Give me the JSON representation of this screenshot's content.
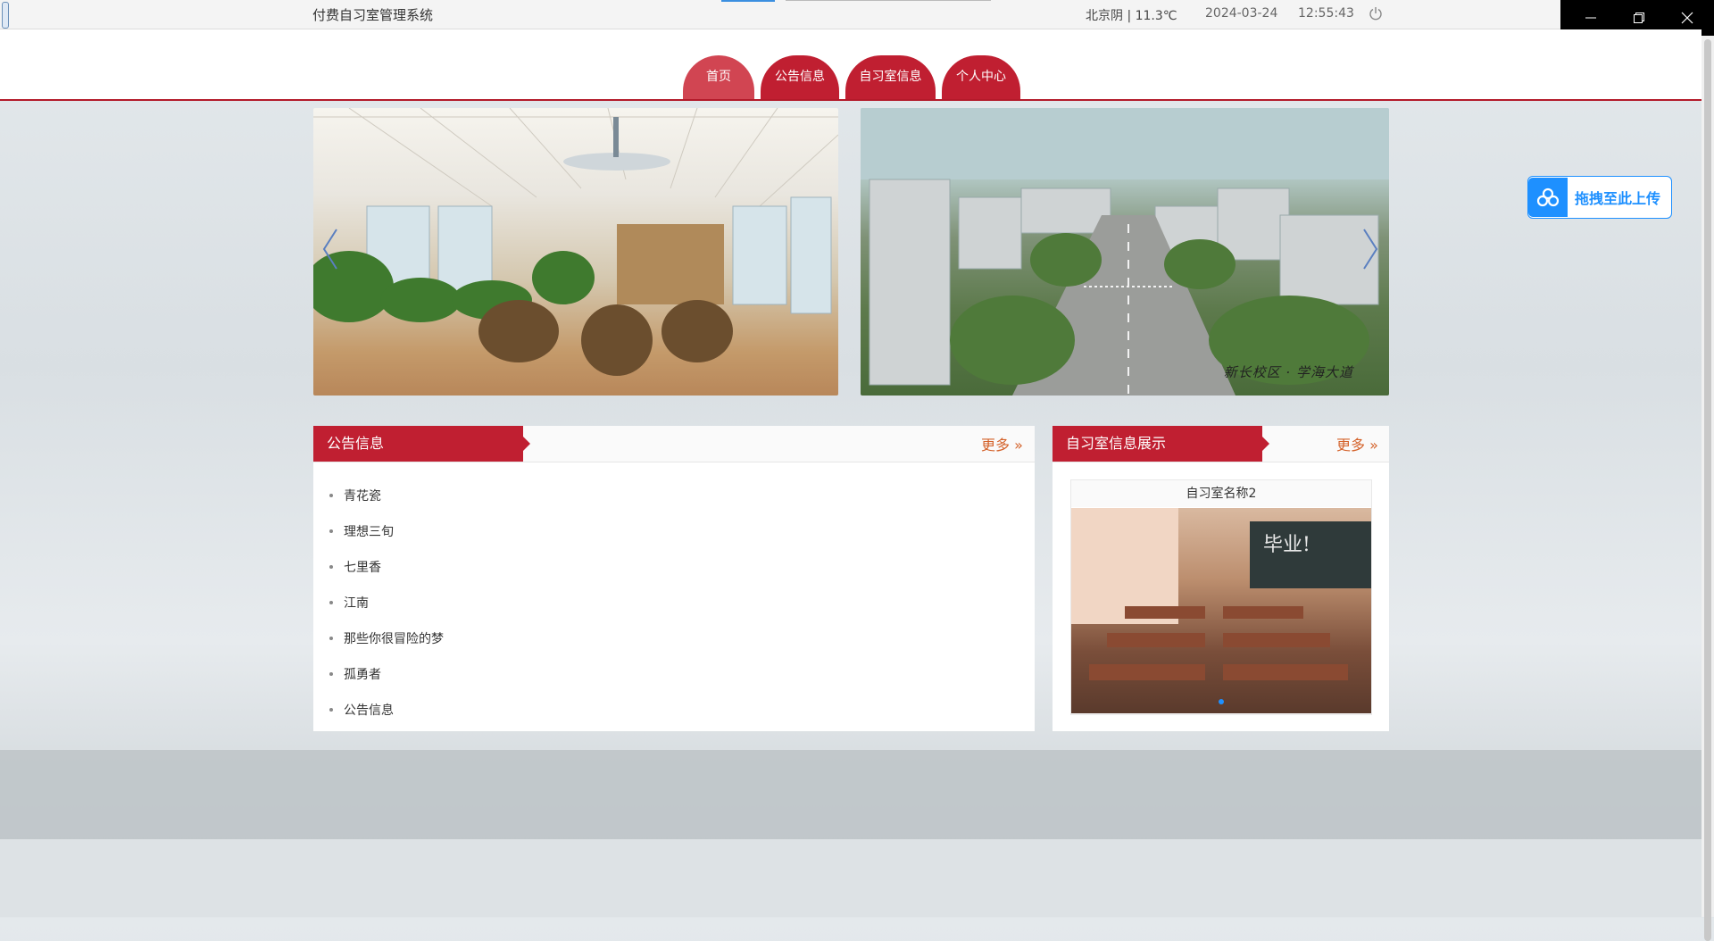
{
  "app": {
    "title": "付费自习室管理系统",
    "weather": "北京阴 | 11.3℃",
    "date": "2024-03-24",
    "time": "12:55:43"
  },
  "nav": {
    "items": [
      {
        "label": "首页",
        "active": true
      },
      {
        "label": "公告信息",
        "active": false
      },
      {
        "label": "自习室信息",
        "active": false
      },
      {
        "label": "个人中心",
        "active": false
      }
    ]
  },
  "carousel": {
    "slide2_caption": "新长校区 · 学海大道"
  },
  "notice_panel": {
    "title": "公告信息",
    "more_label": "更多",
    "items": [
      "青花瓷",
      "理想三旬",
      "七里香",
      "江南",
      "那些你很冒险的梦",
      "孤勇者",
      "公告信息"
    ]
  },
  "room_panel": {
    "title": "自习室信息展示",
    "more_label": "更多",
    "room_name": "自习室名称2",
    "board_text": "毕业!"
  },
  "upload_widget": {
    "label": "拖拽至此上传"
  },
  "colors": {
    "brand_red": "#c01f31",
    "more_orange": "#d4622a",
    "upload_blue": "#1e90ff"
  }
}
